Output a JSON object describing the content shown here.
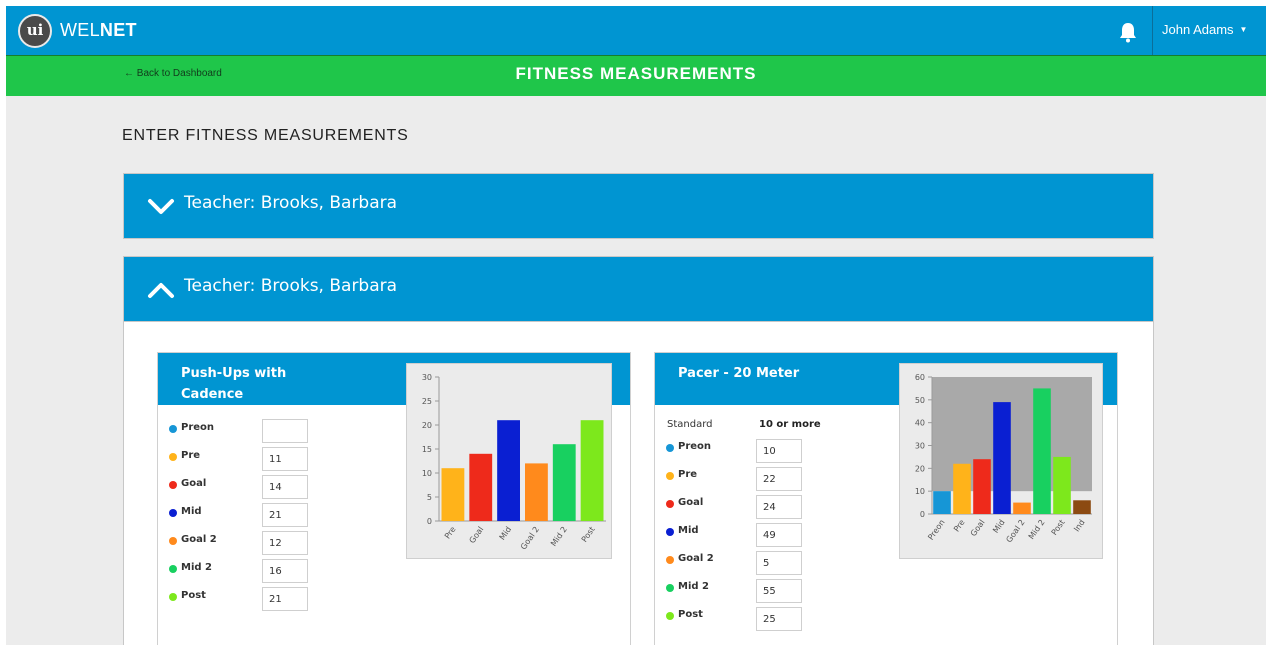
{
  "app": {
    "logo_mark": "ui",
    "brand_left": "WEL",
    "brand_right": "NET",
    "user_name": "John Adams"
  },
  "subheader": {
    "back_link": "← Back to Dashboard",
    "title": "FITNESS MEASUREMENTS"
  },
  "main": {
    "heading": "ENTER FITNESS MEASUREMENTS",
    "panels": [
      {
        "label": "Teacher: Brooks, Barbara",
        "state": "collapsed",
        "icon": "chevron-down-icon"
      },
      {
        "label": "Teacher: Brooks, Barbara",
        "state": "expanded",
        "icon": "chevron-up-icon"
      }
    ]
  },
  "colors": {
    "topbar": "#0095d2",
    "subheader": "#1fc64a",
    "Preon": "#1696d6",
    "Pre": "#ffb31a",
    "Goal": "#ee2a1b",
    "Mid": "#0a1fd2",
    "Goal 2": "#ff8a1c",
    "Mid 2": "#18d060",
    "Post": "#7de81c",
    "Ind": "#8c4a12"
  },
  "cards": [
    {
      "title_line1": "Push-Ups with",
      "title_line2": "Cadence",
      "rows": [
        {
          "label": "Preon",
          "value": ""
        },
        {
          "label": "Pre",
          "value": "11"
        },
        {
          "label": "Goal",
          "value": "14"
        },
        {
          "label": "Mid",
          "value": "21"
        },
        {
          "label": "Goal 2",
          "value": "12"
        },
        {
          "label": "Mid 2",
          "value": "16"
        },
        {
          "label": "Post",
          "value": "21"
        }
      ]
    },
    {
      "title_line1": "Pacer - 20 Meter",
      "standard_label": "Standard",
      "standard_value": "10 or more",
      "rows": [
        {
          "label": "Preon",
          "value": "10"
        },
        {
          "label": "Pre",
          "value": "22"
        },
        {
          "label": "Goal",
          "value": "24"
        },
        {
          "label": "Mid",
          "value": "49"
        },
        {
          "label": "Goal 2",
          "value": "5"
        },
        {
          "label": "Mid 2",
          "value": "55"
        },
        {
          "label": "Post",
          "value": "25"
        }
      ]
    }
  ],
  "chart_data": [
    {
      "type": "bar",
      "categories": [
        "Pre",
        "Goal",
        "Mid",
        "Goal 2",
        "Mid 2",
        "Post"
      ],
      "values": [
        11,
        14,
        21,
        12,
        16,
        21
      ],
      "colors": [
        "#ffb31a",
        "#ee2a1b",
        "#0a1fd2",
        "#ff8a1c",
        "#18d060",
        "#7de81c"
      ],
      "ylim": [
        0,
        30
      ],
      "yticks": [
        0,
        5,
        10,
        15,
        20,
        25,
        30
      ],
      "shaded_band": null
    },
    {
      "type": "bar",
      "categories": [
        "Preon",
        "Pre",
        "Goal",
        "Mid",
        "Goal 2",
        "Mid 2",
        "Post",
        "Ind"
      ],
      "values": [
        10,
        22,
        24,
        49,
        5,
        55,
        25,
        6
      ],
      "colors": [
        "#1696d6",
        "#ffb31a",
        "#ee2a1b",
        "#0a1fd2",
        "#ff8a1c",
        "#18d060",
        "#7de81c",
        "#8c4a12"
      ],
      "ylim": [
        0,
        60
      ],
      "yticks": [
        0,
        10,
        20,
        30,
        40,
        50,
        60
      ],
      "shaded_band": [
        10,
        60
      ]
    }
  ]
}
